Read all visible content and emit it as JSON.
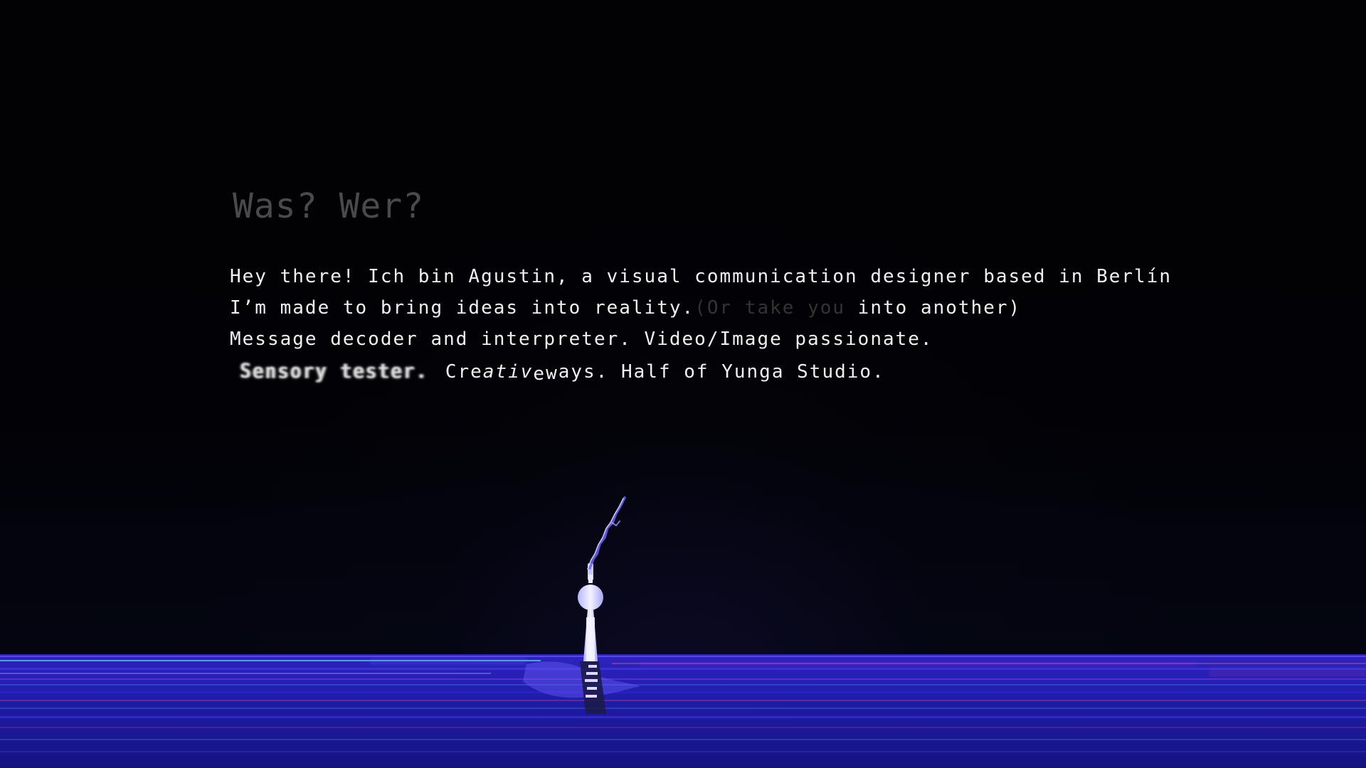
{
  "content": {
    "title": "Was? Wer?",
    "line1": "Hey there! Ich bin Agustin, a visual communication designer based in Berlín",
    "line2_a": "I’m made to bring ideas into reality.",
    "line2_b": "(Or take you",
    "line2_c": " into another)",
    "line3": "Message decoder and interpreter. Video/Image passionate.",
    "line4_glitch": "Sensory tester.",
    "line4_creative_a": "Cre",
    "line4_creative_b": "ativ",
    "line4_creative_c": "e",
    "line4_ways_a": " w",
    "line4_ways_b": "ays.",
    "line4_tail": " Half of Yunga Studio."
  },
  "visual": {
    "scene_icons": [
      "tv-tower-icon",
      "lightning-icon",
      "water-reflection-icon"
    ],
    "colors": {
      "background": "#030308",
      "text_primary": "#f2f2f2",
      "text_muted": "#343434",
      "title": "#4a4a4a",
      "water_blue": "#1b1b98",
      "accent_red": "#ff3355",
      "accent_cyan": "#52e4ff",
      "accent_violet": "#b33cff",
      "tower": "#e7e5ff"
    }
  }
}
